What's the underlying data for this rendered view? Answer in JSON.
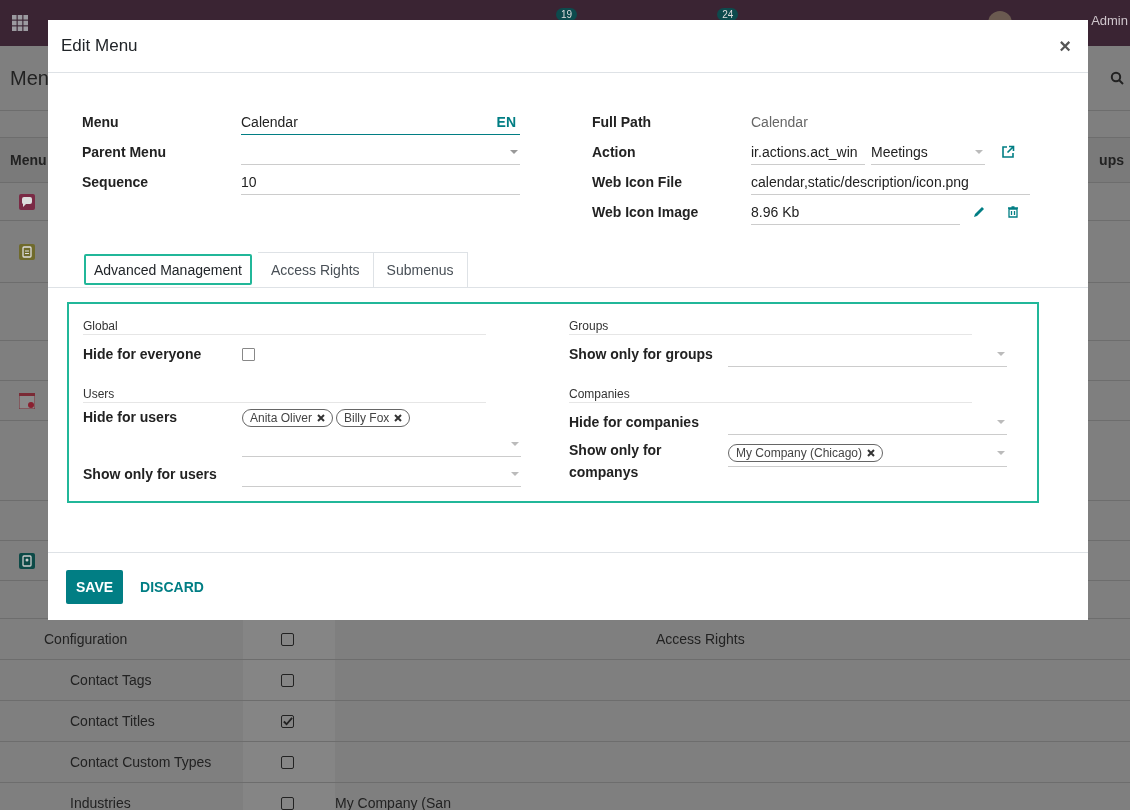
{
  "navbar": {
    "messages_count": "19",
    "activities_count": "24",
    "user": "Admin"
  },
  "control_panel": {
    "title": "Men"
  },
  "list": {
    "header_first": "Menu",
    "header_last": "ups",
    "app_rows": [
      {
        "kind": "chat"
      },
      {
        "kind": "note"
      },
      {
        "kind": "blank"
      },
      {
        "kind": "blank"
      },
      {
        "kind": "calendar"
      },
      {
        "kind": "blank"
      },
      {
        "kind": "blank"
      },
      {
        "kind": "contacts"
      },
      {
        "kind": "blank"
      }
    ],
    "rows": [
      {
        "name": "Configuration",
        "indent": false,
        "checked": false,
        "column_5": "Access Rights"
      },
      {
        "name": "Contact Tags",
        "indent": true,
        "checked": false
      },
      {
        "name": "Contact Titles",
        "indent": true,
        "checked": true
      },
      {
        "name": "Contact Custom Types",
        "indent": true,
        "checked": false
      },
      {
        "name": "Industries",
        "indent": true,
        "checked": false,
        "column_4": "My Company (San"
      }
    ]
  },
  "dialog": {
    "title": "Edit Menu",
    "close": "×",
    "menu": {
      "label": "Menu",
      "value": "Calendar",
      "lang": "EN"
    },
    "parent_menu": {
      "label": "Parent Menu"
    },
    "sequence": {
      "label": "Sequence",
      "value": "10"
    },
    "full_path": {
      "label": "Full Path",
      "value": "Calendar"
    },
    "action": {
      "label": "Action",
      "model": "ir.actions.act_win",
      "record": "Meetings"
    },
    "web_icon_file": {
      "label": "Web Icon File",
      "value": "calendar,static/description/icon.png"
    },
    "web_icon_image": {
      "label": "Web Icon Image",
      "value": "8.96 Kb"
    },
    "tabs": [
      {
        "label": "Advanced Management",
        "selected": true
      },
      {
        "label": "Access Rights",
        "selected": false
      },
      {
        "label": "Submenus",
        "selected": false
      }
    ],
    "global": {
      "title": "Global",
      "hide_for_everyone": {
        "label": "Hide for everyone",
        "checked": false
      }
    },
    "users": {
      "title": "Users",
      "hide_for_users": {
        "label": "Hide for users",
        "tags": [
          "Anita Oliver",
          "Billy Fox"
        ]
      },
      "show_only_for_users": {
        "label": "Show only for users"
      }
    },
    "groups": {
      "title": "Groups",
      "show_only_for_groups": {
        "label": "Show only for groups"
      }
    },
    "companies": {
      "title": "Companies",
      "hide_for_companies": {
        "label": "Hide for companies"
      },
      "show_only_for_companys": {
        "label": "Show only for companys",
        "tags": [
          "My Company (Chicago)"
        ]
      }
    },
    "buttons": {
      "save": "SAVE",
      "discard": "DISCARD"
    }
  }
}
